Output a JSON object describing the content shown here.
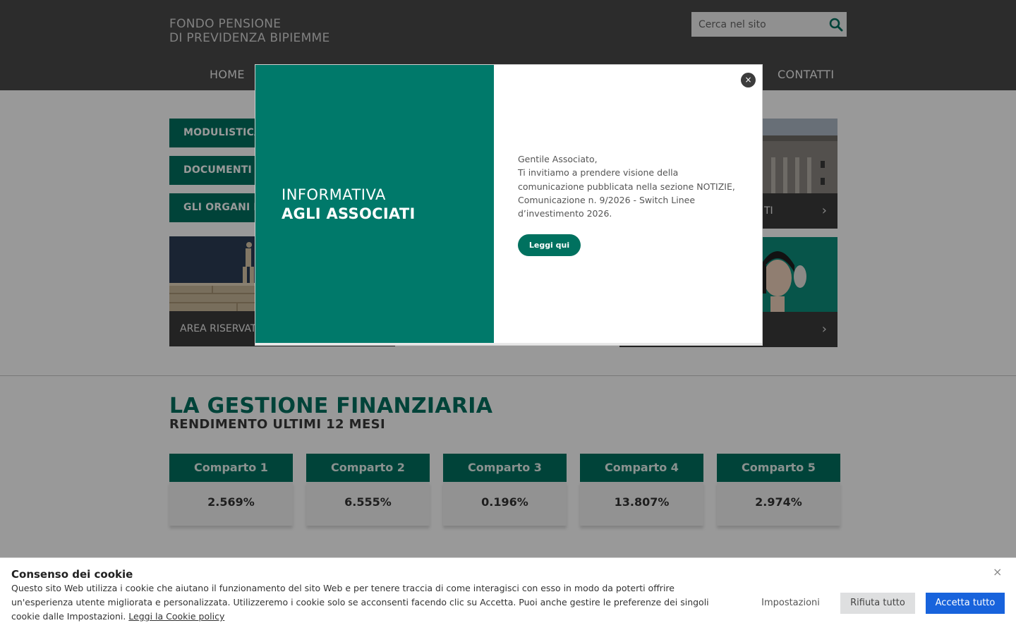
{
  "header": {
    "logo_line1": "FONDO PENSIONE",
    "logo_line2": "DI PREVIDENZA BIPIEMME",
    "search_placeholder": "Cerca nel sito",
    "nav": [
      "HOME",
      "CONTATTI"
    ]
  },
  "side_buttons": [
    "MODULISTICA",
    "DOCUMENTI D",
    "GLI ORGANI D"
  ],
  "tiles": [
    {
      "label": "AREA RISERVATA"
    },
    {
      "label": "TI"
    },
    {
      "label": ""
    }
  ],
  "finance": {
    "title": "LA GESTIONE FINANZIARIA",
    "subtitle": "RENDIMENTO ULTIMI 12 MESI",
    "comparti": [
      {
        "name": "Comparto 1",
        "value": "2.569%"
      },
      {
        "name": "Comparto 2",
        "value": "6.555%"
      },
      {
        "name": "Comparto 3",
        "value": "0.196%"
      },
      {
        "name": "Comparto 4",
        "value": "13.807%"
      },
      {
        "name": "Comparto 5",
        "value": "2.974%"
      }
    ]
  },
  "modal": {
    "title_line1": "INFORMATIVA",
    "title_line2": "AGLI ASSOCIATI",
    "text_lines": [
      "Gentile Associato,",
      "Ti invitiamo a prendere visione della",
      "comunicazione pubblicata nella sezione NOTIZIE,",
      "Comunicazione n. 9/2026 - Switch Linee",
      "d’investimento 2026."
    ],
    "button_label": "Leggi qui",
    "close_symbol": "×"
  },
  "cookie": {
    "title": "Consenso dei cookie",
    "text": "Questo sito Web utilizza i cookie che aiutano il funzionamento del sito Web e per tenere traccia di come interagisci con esso in modo da poterti offrire un'esperienza utente migliorata e personalizzata. Utilizzeremo i cookie solo se acconsenti facendo clic su Accetta. Puoi anche gestire le preferenze dei singoli cookie dalle Impostazioni. ",
    "link": "Leggi la Cookie policy",
    "settings_label": "Impostazioni",
    "reject_label": "Rifiuta tutto",
    "accept_label": "Accetta tutto",
    "close_symbol": "×",
    "accept_color": "#1863dc"
  },
  "colors": {
    "brand_green": "#00715f",
    "header_gray": "#4a4a4a"
  }
}
